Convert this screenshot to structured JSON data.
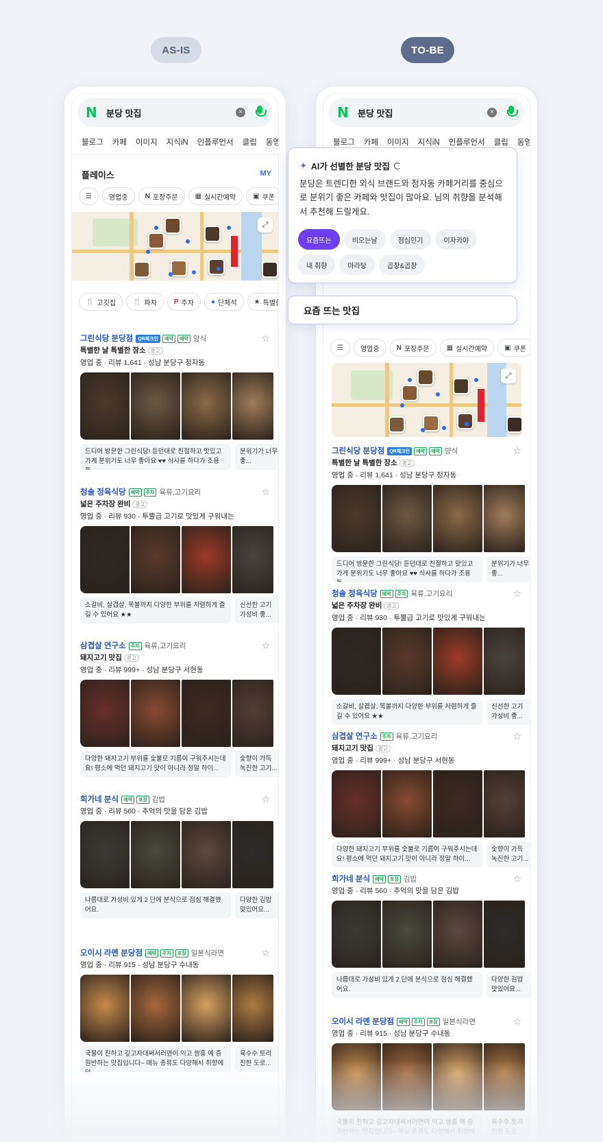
{
  "labels": {
    "asis": "AS-IS",
    "tobe": "TO-BE"
  },
  "search": {
    "query": "분당 맛집"
  },
  "tabs": [
    "블로그",
    "카페",
    "이미지",
    "지식iN",
    "인플루언서",
    "클립",
    "동영상"
  ],
  "place": {
    "title": "플레이스",
    "my": "MY"
  },
  "filters": [
    {
      "icon": "filter-icon",
      "glyph": "☰",
      "label": ""
    },
    {
      "icon": "",
      "glyph": "",
      "label": "영업중"
    },
    {
      "icon": "naver-order-icon",
      "glyph": "N",
      "label": "포장주문"
    },
    {
      "icon": "calendar-icon",
      "glyph": "▦",
      "label": "실시간예약"
    },
    {
      "icon": "coupon-icon",
      "glyph": "▣",
      "label": "쿠폰"
    }
  ],
  "categories": [
    {
      "icon": "fork-icon",
      "glyph": "🍴",
      "label": "고깃집"
    },
    {
      "icon": "fork-icon",
      "glyph": "🍴",
      "label": "파차"
    },
    {
      "icon": "parking-icon",
      "glyph": "P",
      "label": "주차"
    },
    {
      "icon": "group-icon",
      "glyph": "●",
      "label": "단체석"
    },
    {
      "icon": "special-icon",
      "glyph": "★",
      "label": "특별한"
    }
  ],
  "ai": {
    "title": "AI가 선별한 분당 맛집",
    "text": "분당은 트렌디한 외식 브랜드와 정자동 카페거리를 중심으로 분위기 좋은 카페와 맛집이 많아요. 님의 취향을 분석해서 추천해 드릴게요.",
    "chips": [
      "요즘뜨는",
      "비오는날",
      "점심인기",
      "이자카야",
      "내 취향",
      "마라탕",
      "곱창&곱창"
    ],
    "trend_title": "요즘 뜨는 맛집"
  },
  "listings": [
    {
      "name": "그린식당 분당점",
      "badges": [
        "QR체크인",
        "예약",
        "예약"
      ],
      "category": "양식",
      "desc": "특별한 날 특별한 장소",
      "tag": "광고",
      "meta": "영업 중 · 리뷰 1,641 · 성남 분당구 정자동",
      "photos": [
        "#4a3a2c",
        "#6b5a44",
        "#8a6b48",
        "#a07d5a"
      ],
      "reviews": [
        "드디어 방문한 그린식당! 듣던대로 친절하고 맛있고 가게 분위기도 너무 좋아요 ♥♥ 식사를 하다가 조용돌...",
        "분위기가 너무 좋..."
      ]
    },
    {
      "name": "청솔 정육식당",
      "badges": [
        "예약",
        "주차"
      ],
      "category": "육류,고기요리",
      "desc": "넓은 주차장 완비",
      "tag": "광고",
      "meta": "영업 중 · 리뷰 930 · 투뿔급 고기로 맛있게 구워내는",
      "photos": [
        "#2e2824",
        "#5a3a2c",
        "#9c3a26",
        "#4a4440"
      ],
      "reviews": [
        "소갈비, 살겹살, 목볼까지 다양한 부위를 저렴하게 즐길 수 있어요 ★★",
        "신선한 고기 가성비 좋..."
      ]
    },
    {
      "name": "삼겹살 연구소",
      "badges": [
        "주차"
      ],
      "category": "육류,고기요리",
      "desc": "돼지고기 맛집",
      "tag": "광고",
      "meta": "영업 중 · 리뷰 999+ · 성남 분당구 서현동",
      "photos": [
        "#6a2e2a",
        "#8a4a30",
        "#3a2a22",
        "#524038"
      ],
      "reviews": [
        "다양한 돼지고기 부위를 숯불로 기름이 구워주시는데요! 평소에 먹던 돼지고기 맛이 아니라 정말 하이...",
        "숯향이 가득 녹진한 고기..."
      ]
    },
    {
      "name": "희가네 분식",
      "badges": [
        "예약",
        "포장"
      ],
      "category": "김밥",
      "desc": "",
      "tag": "",
      "meta": "영업 중 · 리뷰 560 · 추억의 맛을 담은 김밥",
      "photos": [
        "#3a3a34",
        "#4a4a3e",
        "#5a4a40",
        "#2c2c2a"
      ],
      "reviews": [
        "나름대로 가성비 있게 2 단에 분식으로 점심 해결했어요.",
        "다양한 김밥 맛있어요..."
      ]
    },
    {
      "name": "오이시 라멘 분당점",
      "badges": [
        "예약",
        "주차",
        "포장"
      ],
      "category": "일본식라면",
      "desc": "",
      "tag": "",
      "meta": "영업 중 · 리뷰 915 · 성남 분당구 수내동",
      "photos": [
        "#c88a4a",
        "#a8683a",
        "#d8a060",
        "#b07a40"
      ],
      "reviews": [
        "국물이 진하고 깊고자대써서러면이 익고 쌈홍 예 증원반하는 맛집입니다~ 매뉴 종류도 다양해서 취향에 맞...",
        "육수수 토리 진한 도로..."
      ]
    }
  ]
}
